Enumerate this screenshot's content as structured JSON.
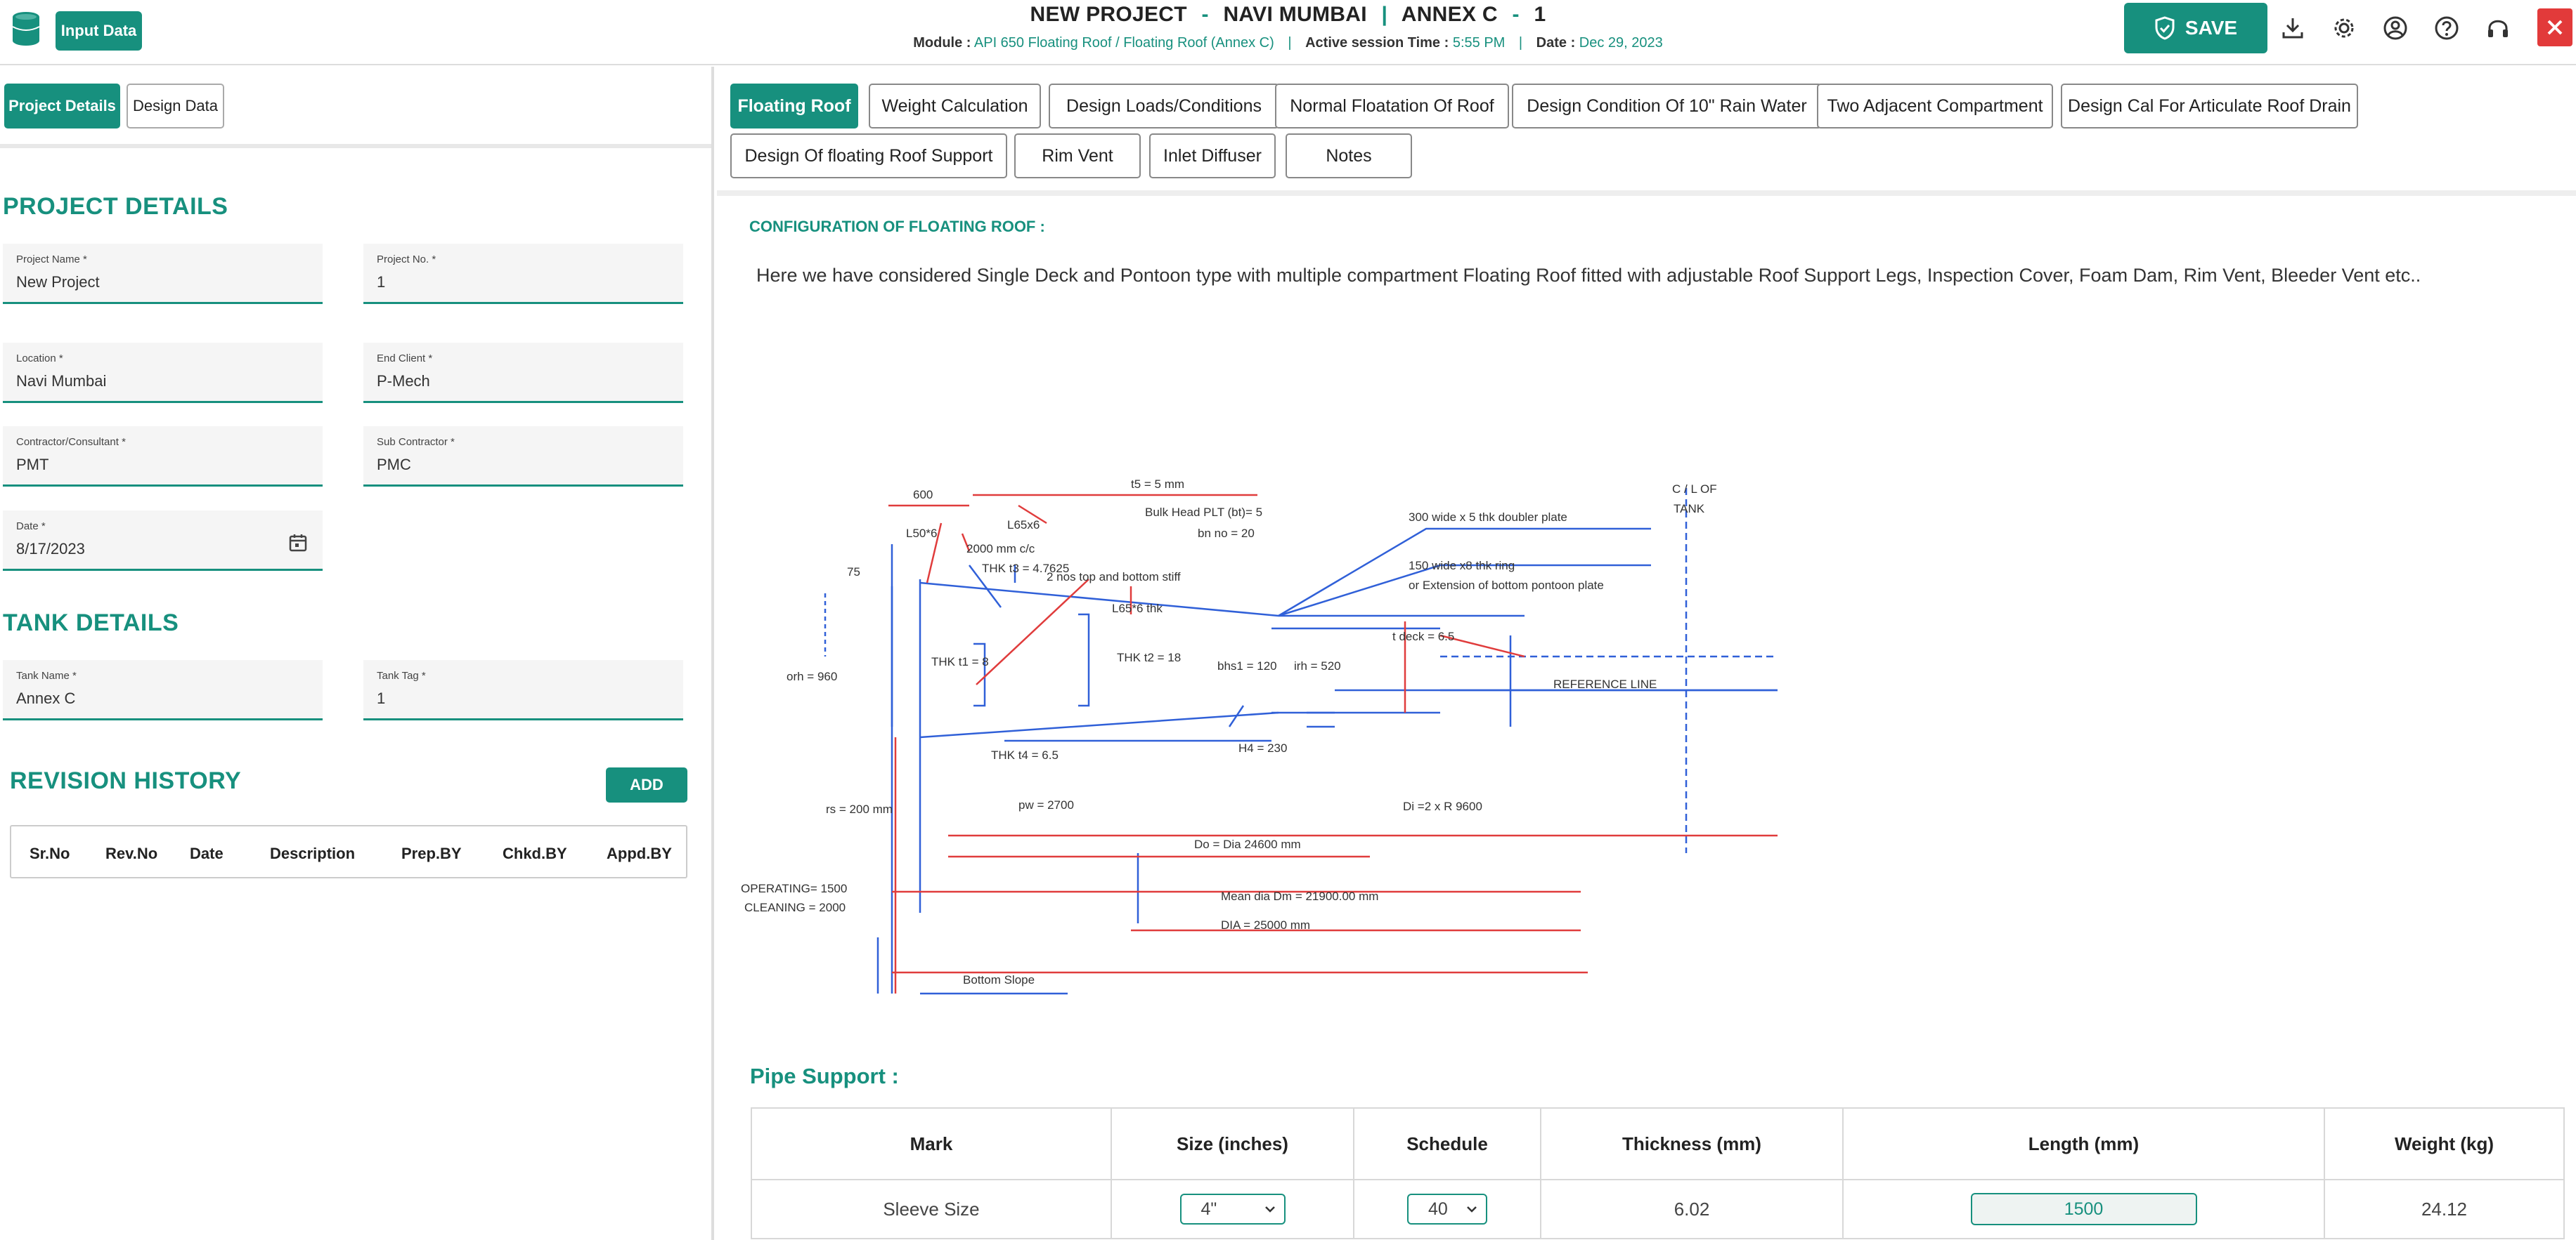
{
  "header": {
    "input_data_label": "Input Data",
    "project": "NEW PROJECT",
    "location": "NAVI MUMBAI",
    "annex": "ANNEX C",
    "annex_no": "1",
    "dash1": "-",
    "dash2": "-",
    "module_label": "Module :",
    "module_value": "API 650 Floating Roof / Floating Roof (Annex C)",
    "session_label": "Active session Time :",
    "session_value": "5:55 PM",
    "date_label": "Date :",
    "date_value": "Dec 29, 2023",
    "save_label": "SAVE"
  },
  "left_tabs": [
    "Project Details",
    "Design Data"
  ],
  "project_details": {
    "heading": "PROJECT DETAILS",
    "fields": [
      {
        "label": "Project Name *",
        "value": "New Project"
      },
      {
        "label": "Project No. *",
        "value": "1"
      },
      {
        "label": "Location *",
        "value": "Navi Mumbai"
      },
      {
        "label": "End Client *",
        "value": "P-Mech"
      },
      {
        "label": "Contractor/Consultant *",
        "value": "PMT"
      },
      {
        "label": "Sub Contractor *",
        "value": "PMC"
      },
      {
        "label": "Date *",
        "value": "8/17/2023"
      }
    ]
  },
  "tank_details": {
    "heading": "TANK DETAILS",
    "fields": [
      {
        "label": "Tank Name *",
        "value": "Annex C"
      },
      {
        "label": "Tank Tag *",
        "value": "1"
      }
    ]
  },
  "revision": {
    "heading": "REVISION HISTORY",
    "add_label": "ADD",
    "columns": [
      "Sr.No",
      "Rev.No",
      "Date",
      "Description",
      "Prep.BY",
      "Chkd.BY",
      "Appd.BY"
    ]
  },
  "right_tabs": [
    "Floating Roof",
    "Weight Calculation",
    "Design Loads/Conditions",
    "Normal Floatation Of Roof",
    "Design Condition Of 10\" Rain Water",
    "Two Adjacent Compartment",
    "Design Cal For Articulate Roof Drain",
    "Design Of floating Roof Support",
    "Rim Vent",
    "Inlet Diffuser",
    "Notes"
  ],
  "config": {
    "title": "CONFIGURATION OF FLOATING ROOF :",
    "text": "Here we have considered Single Deck and Pontoon type with multiple compartment Floating Roof fitted with adjustable Roof Support Legs, Inspection Cover, Foam Dam, Rim Vent, Bleeder Vent etc.."
  },
  "drawing": {
    "labels": [
      "600",
      "t5 = 5 mm",
      "L65x6",
      "Bulk Head PLT (bt)= 5",
      "bn no = 20",
      "L50*6",
      "2000 mm c/c",
      "THK t3 = 4.7625",
      "2 nos top and bottom stiff",
      "75",
      "L65*6 thk",
      "300 wide x 5 thk doubler plate",
      "150 wide x8 thk ring",
      "or Extension of bottom pontoon plate",
      "C / L OF",
      "TANK",
      "t deck = 6.5",
      "orh = 960",
      "THK t1 = 8",
      "THK t2 = 18",
      "bhs1 = 120",
      "irh = 520",
      "REFERENCE LINE",
      "H4 = 230",
      "THK t4 = 6.5",
      "rs = 200 mm",
      "pw = 2700",
      "Di =2 x R 9600",
      "Do = Dia 24600 mm",
      "OPERATING= 1500",
      "CLEANING = 2000",
      "Mean dia Dm = 21900.00 mm",
      "DIA = 25000 mm",
      "Bottom Slope"
    ]
  },
  "pipe_support": {
    "title": "Pipe Support :",
    "columns": [
      "Mark",
      "Size (inches)",
      "Schedule",
      "Thickness (mm)",
      "Length (mm)",
      "Weight (kg)"
    ],
    "rows": [
      {
        "mark": "Sleeve Size",
        "size": "4\"",
        "schedule": "40",
        "thickness": "6.02",
        "length": "1500",
        "weight": "24.12"
      }
    ]
  },
  "colors": {
    "accent": "#17907e",
    "close": "#e23a3a"
  }
}
